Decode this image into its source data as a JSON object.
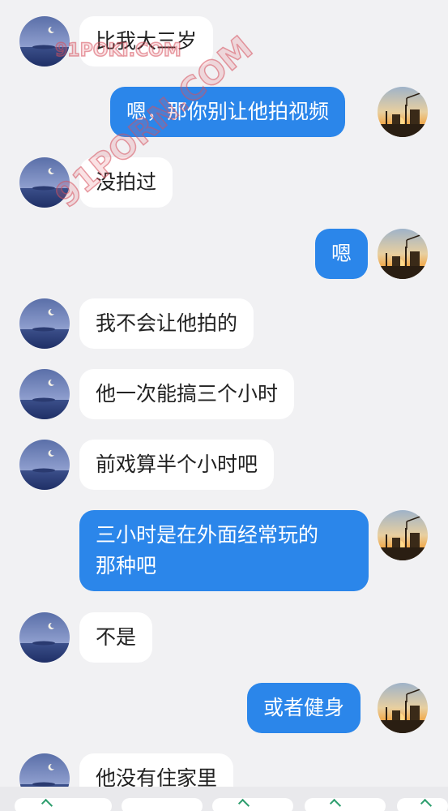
{
  "watermark": {
    "small": "91POKI.COM",
    "diagonal": "91PORN.COM"
  },
  "messages": [
    {
      "side": "left",
      "text": "比我大三岁"
    },
    {
      "side": "right",
      "text": "嗯，那你别让他拍视频"
    },
    {
      "side": "left",
      "text": "没拍过"
    },
    {
      "side": "right",
      "text": "嗯"
    },
    {
      "side": "left",
      "text": "我不会让他拍的"
    },
    {
      "side": "left",
      "text": "他一次能搞三个小时"
    },
    {
      "side": "left",
      "text": "前戏算半个小时吧"
    },
    {
      "side": "right",
      "lines": [
        "三小时是在外面经常玩的",
        "那种吧"
      ]
    },
    {
      "side": "left",
      "text": "不是"
    },
    {
      "side": "right",
      "text": "或者健身"
    },
    {
      "side": "left",
      "text": "他没有住家里"
    }
  ],
  "colors": {
    "background": "#f1f1f3",
    "incoming_bubble": "#ffffff",
    "outgoing_bubble": "#2b86ea",
    "incoming_text": "#222222",
    "outgoing_text": "#ffffff"
  },
  "avatars": {
    "contact": "moon-over-sea-avatar-icon",
    "self": "sunset-construction-avatar-icon"
  }
}
